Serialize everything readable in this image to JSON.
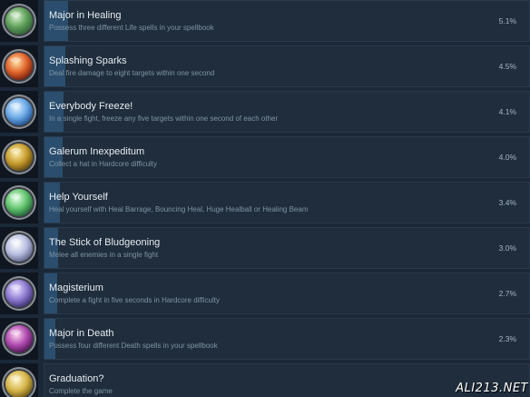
{
  "achievements": [
    {
      "title": "Major in Healing",
      "description": "Possess three different Life spells in your spellbook",
      "percent": "5.1%",
      "fill_fraction": 0.051,
      "icon": "heal-scroll-icon",
      "icon_colors": [
        "#d8f2d0",
        "#5fa05a",
        "#2f5e36"
      ]
    },
    {
      "title": "Splashing Sparks",
      "description": "Deal fire damage to eight targets within one second",
      "percent": "4.5%",
      "fill_fraction": 0.045,
      "icon": "fire-burst-icon",
      "icon_colors": [
        "#ffe1a6",
        "#e0632a",
        "#6a1b0f"
      ]
    },
    {
      "title": "Everybody Freeze!",
      "description": "In a single fight, freeze any five targets within one second of each other",
      "percent": "4.1%",
      "fill_fraction": 0.041,
      "icon": "frozen-figure-icon",
      "icon_colors": [
        "#e4f4ff",
        "#6aa9e6",
        "#1d4c8a"
      ]
    },
    {
      "title": "Galerum Inexpeditum",
      "description": "Collect a hat in Hardcore difficulty",
      "percent": "4.0%",
      "fill_fraction": 0.04,
      "icon": "wizard-hat-icon",
      "icon_colors": [
        "#fff1b3",
        "#c79d2e",
        "#5e4410"
      ]
    },
    {
      "title": "Help Yourself",
      "description": "Heal yourself with Heal Barrage, Bouncing Heal, Huge Healball or Healing Beam",
      "percent": "3.4%",
      "fill_fraction": 0.034,
      "icon": "healing-hand-icon",
      "icon_colors": [
        "#e4ffe6",
        "#62c46e",
        "#1f5f34"
      ]
    },
    {
      "title": "The Stick of Bludgeoning",
      "description": "Melee all enemies in a single fight",
      "percent": "3.0%",
      "fill_fraction": 0.03,
      "icon": "staff-strike-icon",
      "icon_colors": [
        "#ffffff",
        "#b9bfe0",
        "#5b5f86"
      ]
    },
    {
      "title": "Magisterium",
      "description": "Complete a fight in five seconds in Hardcore difficulty",
      "percent": "2.7%",
      "fill_fraction": 0.027,
      "icon": "stopwatch-icon",
      "icon_colors": [
        "#e9e3ff",
        "#8e7bd2",
        "#3a2e6e"
      ]
    },
    {
      "title": "Major in Death",
      "description": "Possess four different Death spells in your spellbook",
      "percent": "2.3%",
      "fill_fraction": 0.023,
      "icon": "death-scroll-icon",
      "icon_colors": [
        "#ffd6f0",
        "#b04bb0",
        "#4a1450"
      ]
    },
    {
      "title": "Graduation?",
      "description": "Complete the game",
      "percent": "",
      "fill_fraction": 0.0,
      "icon": "laurel-wreath-icon",
      "icon_colors": [
        "#fff6cf",
        "#d6b648",
        "#6b5416"
      ]
    }
  ],
  "watermark": "ALI213.NET"
}
